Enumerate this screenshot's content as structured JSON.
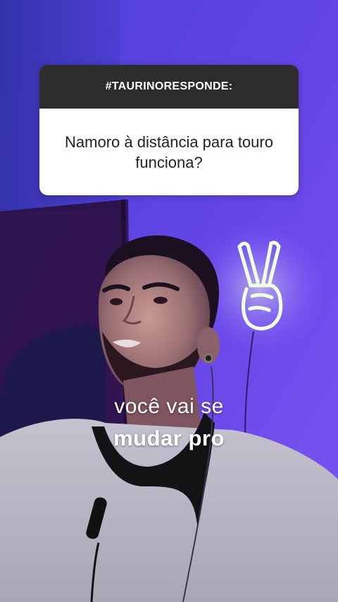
{
  "question_box": {
    "header": "#TAURINORESPONDE:",
    "question": "Namoro à distância para touro funciona?"
  },
  "caption": {
    "line1": "você vai se",
    "line2": "mudar pro"
  },
  "colors": {
    "wall": "#5b3fe0",
    "neon": "#e9ffd9",
    "sweater": "#b9b7c4",
    "collar": "#161414"
  },
  "icons": [
    "peace-sign-neon-icon"
  ]
}
